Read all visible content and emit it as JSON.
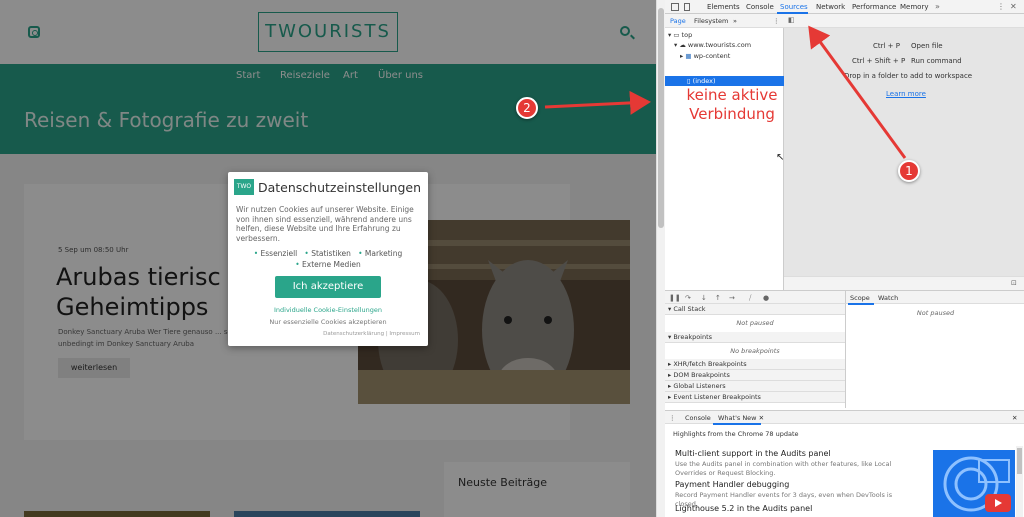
{
  "site": {
    "logo": "TWOURISTS",
    "nav": [
      "Start",
      "Reiseziele",
      "Art",
      "Über uns"
    ],
    "hero_title": "Reisen & Fotografie zu zweit",
    "post": {
      "date": "5 Sep um 08:50 Uhr",
      "title": "Arubas tierisc Geheimtipps",
      "excerpt": "Donkey Sanctuary Aruba Wer Tiere genauso ... seinem Besuch auf Aruba unbedingt im Donkey Sanctuary Aruba",
      "read_more": "weiterlesen"
    },
    "sidebar_title": "Neuste Beiträge"
  },
  "cookie": {
    "logo": "TWO",
    "title": "Datenschutzeinstellungen",
    "body": "Wir nutzen Cookies auf unserer Website. Einige von ihnen sind essenziell, während andere uns helfen, diese Website und Ihre Erfahrung zu verbessern.",
    "categories": [
      "Essenziell",
      "Statistiken",
      "Marketing",
      "Externe Medien"
    ],
    "accept": "Ich akzeptiere",
    "individual": "Individuelle Cookie-Einstellungen",
    "essential_only": "Nur essenzielle Cookies akzeptieren",
    "footer": "Datenschutzerklärung | Impressum"
  },
  "devtools": {
    "tabs": [
      "Elements",
      "Console",
      "Sources",
      "Network",
      "Performance",
      "Memory"
    ],
    "active_tab": "Sources",
    "nav_tabs": [
      "Page",
      "Filesystem"
    ],
    "tree": [
      "top",
      "www.twourists.com",
      "wp-content",
      "(index)"
    ],
    "shortcuts": [
      {
        "keys": "Ctrl + P",
        "label": "Open file"
      },
      {
        "keys": "Ctrl + Shift + P",
        "label": "Run command"
      }
    ],
    "drop_hint": "Drop in a folder to add to workspace",
    "learn_more": "Learn more",
    "sections": [
      "Call Stack",
      "Breakpoints",
      "XHR/fetch Breakpoints",
      "DOM Breakpoints",
      "Global Listeners",
      "Event Listener Breakpoints"
    ],
    "not_paused": "Not paused",
    "no_breakpoints": "No breakpoints",
    "scope_tabs": [
      "Scope",
      "Watch"
    ],
    "drawer_tabs": [
      "Console",
      "What's New"
    ],
    "drawer_sub": "Highlights from the Chrome 78 update",
    "whats_new": [
      {
        "title": "Multi-client support in the Audits panel",
        "desc": "Use the Audits panel in combination with other features, like Local Overrides or Request Blocking."
      },
      {
        "title": "Payment Handler debugging",
        "desc": "Record Payment Handler events for 3 days, even when DevTools is closed."
      },
      {
        "title": "Lighthouse 5.2 in the Audits panel",
        "desc": ""
      }
    ]
  },
  "annotations": {
    "badge1": "1",
    "badge2": "2",
    "text": "keine aktive Verbindung",
    "color": "#e53935"
  }
}
